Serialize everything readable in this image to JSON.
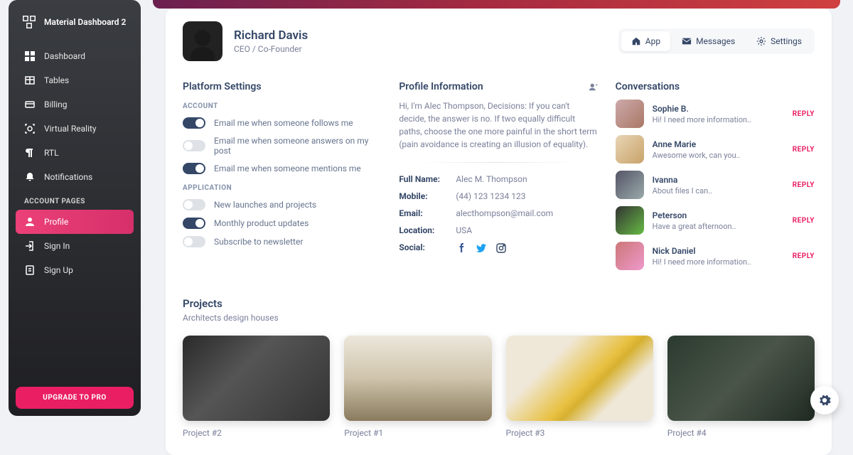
{
  "brand": "Material Dashboard 2",
  "nav": {
    "items": [
      {
        "label": "Dashboard"
      },
      {
        "label": "Tables"
      },
      {
        "label": "Billing"
      },
      {
        "label": "Virtual Reality"
      },
      {
        "label": "RTL"
      },
      {
        "label": "Notifications"
      }
    ],
    "section": "ACCOUNT PAGES",
    "account_items": [
      {
        "label": "Profile"
      },
      {
        "label": "Sign In"
      },
      {
        "label": "Sign Up"
      }
    ],
    "upgrade": "UPGRADE TO PRO"
  },
  "profile": {
    "name": "Richard Davis",
    "role": "CEO / Co-Founder"
  },
  "tabs": {
    "app": "App",
    "messages": "Messages",
    "settings": "Settings"
  },
  "platform": {
    "title": "Platform Settings",
    "account_head": "ACCOUNT",
    "app_head": "APPLICATION",
    "opts": [
      "Email me when someone follows me",
      "Email me when someone answers on my post",
      "Email me when someone mentions me",
      "New launches and projects",
      "Monthly product updates",
      "Subscribe to newsletter"
    ]
  },
  "info": {
    "title": "Profile Information",
    "bio": "Hi, I'm Alec Thompson, Decisions: If you can't decide, the answer is no. If two equally difficult paths, choose the one more painful in the short term (pain avoidance is creating an illusion of equality).",
    "full_name_label": "Full Name:",
    "full_name": "Alec M. Thompson",
    "mobile_label": "Mobile:",
    "mobile": "(44) 123 1234 123",
    "email_label": "Email:",
    "email": "alecthompson@mail.com",
    "location_label": "Location:",
    "location": "USA",
    "social_label": "Social:"
  },
  "conversations": {
    "title": "Conversations",
    "reply": "REPLY",
    "items": [
      {
        "name": "Sophie B.",
        "msg": "Hi! I need more information.."
      },
      {
        "name": "Anne Marie",
        "msg": "Awesome work, can you.."
      },
      {
        "name": "Ivanna",
        "msg": "About files I can.."
      },
      {
        "name": "Peterson",
        "msg": "Have a great afternoon.."
      },
      {
        "name": "Nick Daniel",
        "msg": "Hi! I need more information.."
      }
    ]
  },
  "projects": {
    "title": "Projects",
    "subtitle": "Architects design houses",
    "items": [
      {
        "caption": "Project #2"
      },
      {
        "caption": "Project #1"
      },
      {
        "caption": "Project #3"
      },
      {
        "caption": "Project #4"
      }
    ]
  }
}
